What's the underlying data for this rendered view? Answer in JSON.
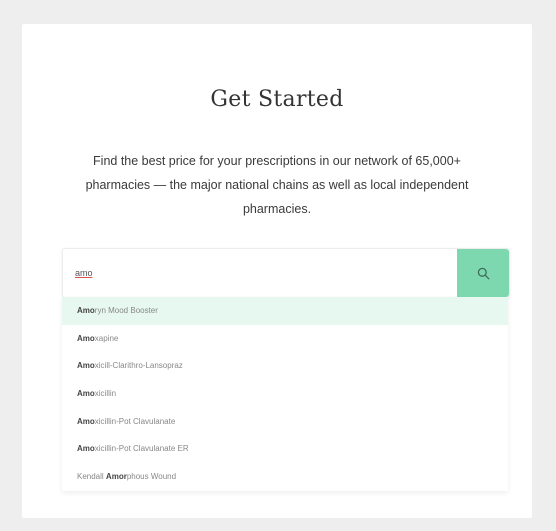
{
  "page": {
    "title": "Get Started",
    "subtitle": "Find the best price for your prescriptions in our network of 65,000+ pharmacies — the major national chains as well as local independent pharmacies."
  },
  "search": {
    "value": "amo",
    "icon": "search-icon"
  },
  "colors": {
    "accent": "#7dd8b0",
    "highlight": "#e6f8ef"
  },
  "suggestions": [
    {
      "match": "Amo",
      "rest": "ryn Mood Booster",
      "active": true
    },
    {
      "match": "Amo",
      "rest": "xapine",
      "active": false
    },
    {
      "match": "Amo",
      "rest": "xicill-Clarithro-Lansopraz",
      "active": false
    },
    {
      "match": "Amo",
      "rest": "xicillin",
      "active": false
    },
    {
      "match": "Amo",
      "rest": "xicillin-Pot Clavulanate",
      "active": false
    },
    {
      "match": "Amo",
      "rest": "xicillin-Pot Clavulanate ER",
      "active": false
    },
    {
      "prefix": "Kendall ",
      "match": "Amor",
      "rest": "phous Wound",
      "active": false
    }
  ]
}
